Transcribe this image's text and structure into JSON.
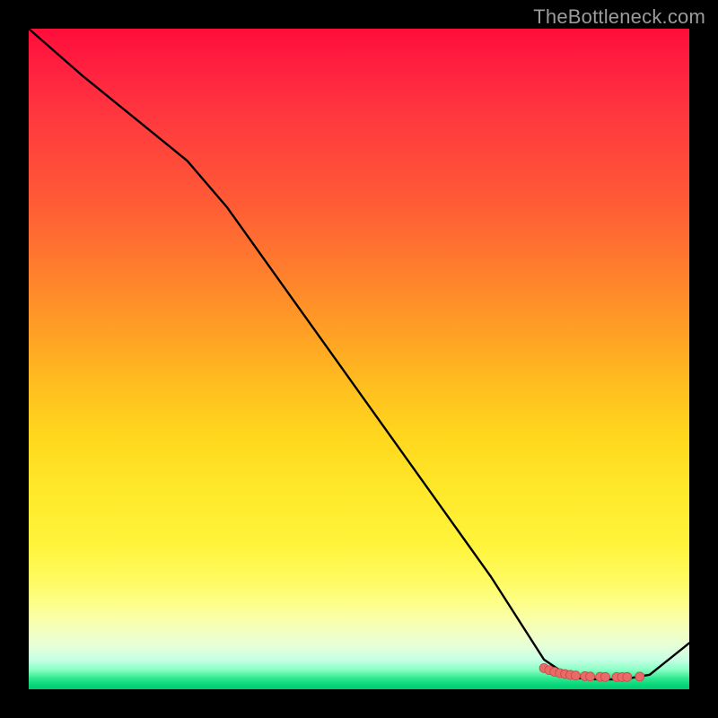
{
  "watermark": "TheBottleneck.com",
  "colors": {
    "line": "#000000",
    "marker_fill": "#ea6a68",
    "marker_stroke": "#c74a48"
  },
  "chart_data": {
    "type": "line",
    "title": "",
    "xlabel": "",
    "ylabel": "",
    "xlim": [
      0,
      100
    ],
    "ylim": [
      0,
      100
    ],
    "grid": false,
    "legend": false,
    "description": "A single black curve plotted over a vertical red→yellow→green gradient. The curve starts at the top-left corner (x≈0, y≈100), descends with a shallow slope to roughly (x≈25, y≈80), then drops nearly linearly to a flat minimum near y≈1.5 across x≈78–92, and rises slightly at the far right (x=100, y≈7). A cluster of small salmon-colored markers sits along the flat minimum near the right side.",
    "series": [
      {
        "name": "curve",
        "x": [
          0,
          8,
          16,
          24,
          30,
          40,
          50,
          60,
          70,
          78,
          82,
          86,
          90,
          94,
          100
        ],
        "y": [
          100,
          93,
          86.5,
          80,
          73,
          59,
          45,
          31,
          17,
          4.5,
          1.8,
          1.5,
          1.5,
          2.2,
          7
        ]
      }
    ],
    "markers": [
      {
        "x": 78.0,
        "y": 3.2
      },
      {
        "x": 78.8,
        "y": 2.9
      },
      {
        "x": 79.6,
        "y": 2.65
      },
      {
        "x": 80.4,
        "y": 2.45
      },
      {
        "x": 81.2,
        "y": 2.3
      },
      {
        "x": 82.0,
        "y": 2.18
      },
      {
        "x": 82.8,
        "y": 2.08
      },
      {
        "x": 84.2,
        "y": 1.98
      },
      {
        "x": 85.0,
        "y": 1.93
      },
      {
        "x": 86.5,
        "y": 1.88
      },
      {
        "x": 87.3,
        "y": 1.86
      },
      {
        "x": 89.0,
        "y": 1.85
      },
      {
        "x": 89.8,
        "y": 1.85
      },
      {
        "x": 90.6,
        "y": 1.86
      },
      {
        "x": 92.5,
        "y": 1.92
      }
    ]
  }
}
